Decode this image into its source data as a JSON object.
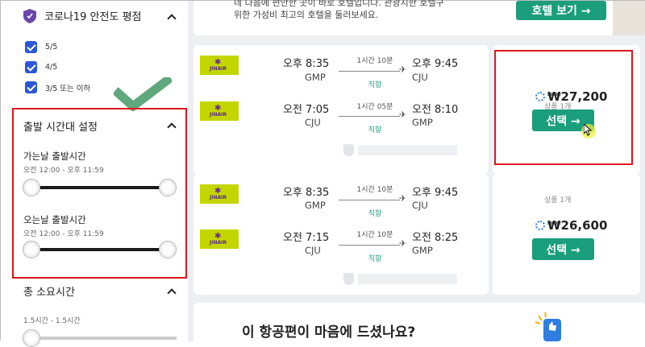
{
  "sidebar": {
    "covid": {
      "title": "코로나19 안전도 평점",
      "options": [
        "5/5",
        "4/5",
        "3/5 또는 이하"
      ]
    },
    "departure_time": {
      "title": "출발 시간대 설정",
      "outbound": {
        "label": "가는날 출발시간",
        "range": "오전 12:00 - 오후 11:59"
      },
      "return": {
        "label": "오는날 출발시간",
        "range": "오전 12:00 - 오후 11:59"
      }
    },
    "duration": {
      "title": "총 소요시간",
      "range": "1.5시간 - 1.5시간"
    }
  },
  "banner": {
    "text_line1": "네 다음에 편안한 곳이 바로 호텔입니다. 관광지한 호텔구",
    "text_line2": "위한 가성비 최고의 호텔을 둘러보세요.",
    "button": "호텔 보기 →"
  },
  "results": [
    {
      "legs": [
        {
          "airline_logo": "JINAIR",
          "dep_time": "오후 8:35",
          "dep_code": "GMP",
          "duration": "1시간 10분",
          "stops": "직항",
          "arr_time": "오후 9:45",
          "arr_code": "CJU"
        },
        {
          "airline_logo": "JINAIR",
          "dep_time": "오전 7:05",
          "dep_code": "CJU",
          "duration": "1시간 05분",
          "stops": "직항",
          "arr_time": "오전 8:10",
          "arr_code": "GMP"
        }
      ],
      "deals": "상품 1개",
      "price": "₩27,200",
      "select": "선택 →"
    },
    {
      "legs": [
        {
          "airline_logo": "JINAIR",
          "dep_time": "오후 8:35",
          "dep_code": "GMP",
          "duration": "1시간 10분",
          "stops": "직항",
          "arr_time": "오후 9:45",
          "arr_code": "CJU"
        },
        {
          "airline_logo": "JINAIR",
          "dep_time": "오전 7:15",
          "dep_code": "CJU",
          "duration": "1시간 10분",
          "stops": "직항",
          "arr_time": "오전 8:25",
          "arr_code": "GMP"
        }
      ],
      "deals": "상품 1개",
      "price": "₩26,600",
      "select": "선택 →"
    }
  ],
  "feedback": {
    "question": "이 항공편이 마음에 드셨나요?"
  },
  "colors": {
    "accent_green": "#1a9e7b",
    "checkbox_blue": "#2c57d6",
    "highlight_red": "#e0131c"
  }
}
